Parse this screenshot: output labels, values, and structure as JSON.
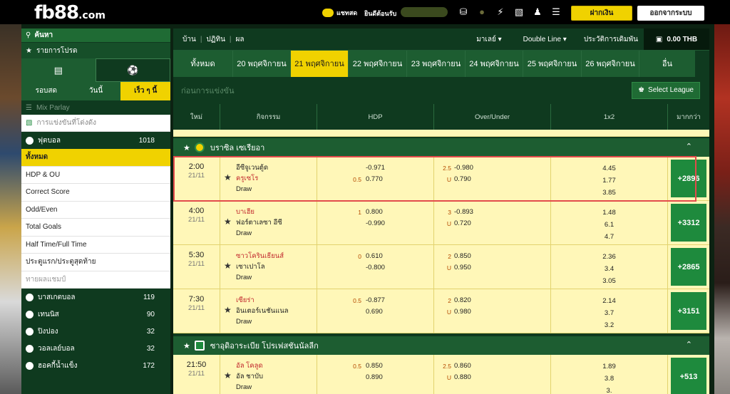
{
  "header": {
    "logo_main": "fb88",
    "logo_suffix": ".com",
    "chat_label": "แชทสด",
    "welcome_label": "ยินดีต้อนรับ",
    "deposit_button": "ฝากเงิน",
    "logout_button": "ออกจากระบบ"
  },
  "sidebar": {
    "search_label": "ค้นหา",
    "favorites_label": "รายการโปรด",
    "tabs": [
      "รอบสด",
      "วันนี้",
      "เร็ว ๆ นี้"
    ],
    "selected_tab": "เร็ว ๆ นี้",
    "mix_parlay": "Mix Parlay",
    "upcoming_events": "การแข่งขันที่โด่งดัง",
    "football": {
      "label": "ฟุตบอล",
      "count": "1018"
    },
    "football_subs": [
      "ทั้งหมด",
      "HDP & OU",
      "Correct Score",
      "Odd/Even",
      "Total Goals",
      "Half Time/Full Time",
      "ประตูแรก/ประตูสุดท้าย",
      "ทายผลแชมป์"
    ],
    "sports": [
      {
        "label": "บาสเกตบอล",
        "count": "119"
      },
      {
        "label": "เทนนิส",
        "count": "90"
      },
      {
        "label": "ปิงปอง",
        "count": "32"
      },
      {
        "label": "วอลเลย์บอล",
        "count": "32"
      },
      {
        "label": "ฮอคกี้น้ำแข็ง",
        "count": "172"
      }
    ]
  },
  "nav": {
    "crumbs": [
      "บ้าน",
      "ปฏิทิน",
      "ผล"
    ],
    "market_dropdown": "มาเลย์",
    "line_dropdown": "Double Line",
    "history_link": "ประวัติการเดิมพัน",
    "balance": "0.00 THB"
  },
  "dates": [
    "ทั้งหมด",
    "20 พฤศจิกายน",
    "21 พฤศจิกายน",
    "22 พฤศจิกายน",
    "23 พฤศจิกายน",
    "24 พฤศจิกายน",
    "25 พฤศจิกายน",
    "26 พฤศจิกายน",
    "อื่น"
  ],
  "selected_date": "21 พฤศจิกายน",
  "prematch_title": "ก่อนการแข่งขัน",
  "select_league_button": "Select League",
  "table_headers": [
    "ใหม่",
    "กิจกรรม",
    "HDP",
    "Over/Under",
    "1x2",
    "มากกว่า"
  ],
  "leagues": [
    {
      "name": "บราซิล เซเรียอา",
      "matches": [
        {
          "time": "2:00",
          "date": "21/11",
          "home": "อีซีจูเวนตู้ด",
          "away": "ครูเซโร",
          "draw": "Draw",
          "hdp_line": "0.5",
          "hdp_home": "-0.971",
          "hdp_away": "0.770",
          "ou_line": "2.5",
          "ou_over": "-0.980",
          "ou_under_label": "U",
          "ou_under": "0.790",
          "x1": "4.45",
          "x2": "1.77",
          "xd": "3.85",
          "more": "+2896"
        },
        {
          "time": "4:00",
          "date": "21/11",
          "home": "บาเฮีย",
          "away": "ฟอร์ตาเลซา อีซี",
          "draw": "Draw",
          "hdp_line": "1",
          "hdp_home": "0.800",
          "hdp_away": "-0.990",
          "ou_line": "3",
          "ou_over": "-0.893",
          "ou_under_label": "U",
          "ou_under": "0.720",
          "x1": "1.48",
          "x2": "6.1",
          "xd": "4.7",
          "more": "+3312"
        },
        {
          "time": "5:30",
          "date": "21/11",
          "home": "ซาวโครินเธียนส์",
          "away": "เซาเปาโล",
          "draw": "Draw",
          "hdp_line": "0",
          "hdp_home": "0.610",
          "hdp_away": "-0.800",
          "ou_line": "2",
          "ou_over": "0.850",
          "ou_under_label": "U",
          "ou_under": "0.950",
          "x1": "2.36",
          "x2": "3.4",
          "xd": "3.05",
          "more": "+2865"
        },
        {
          "time": "7:30",
          "date": "21/11",
          "home": "เซียร่า",
          "away": "อินเตอร์เนชันแนล",
          "draw": "Draw",
          "hdp_line": "0.5",
          "hdp_home": "-0.877",
          "hdp_away": "0.690",
          "ou_line": "2",
          "ou_over": "0.820",
          "ou_under_label": "U",
          "ou_under": "0.980",
          "x1": "2.14",
          "x2": "3.7",
          "xd": "3.2",
          "more": "+3151"
        }
      ]
    },
    {
      "name": "ซาอุดิอาระเบีย โปรเฟสชันนัลลีก",
      "matches": [
        {
          "time": "21:50",
          "date": "21/11",
          "home": "อัล โคลูด",
          "away": "อัล ชาบับ",
          "draw": "Draw",
          "hdp_line": "0.5",
          "hdp_home": "0.850",
          "hdp_away": "0.890",
          "ou_line": "2.5",
          "ou_over": "0.860",
          "ou_under_label": "U",
          "ou_under": "0.880",
          "x1": "1.89",
          "x2": "3.8",
          "xd": "3.",
          "more": "+513"
        }
      ]
    }
  ],
  "colors": {
    "accent": "#f0d200",
    "green_dark": "#0f3a1f",
    "green": "#1d5d31",
    "row_bg": "#fff7b8",
    "more_btn": "#1e8a3d",
    "red_team": "#c1272d",
    "highlight": "#e34b4b"
  }
}
